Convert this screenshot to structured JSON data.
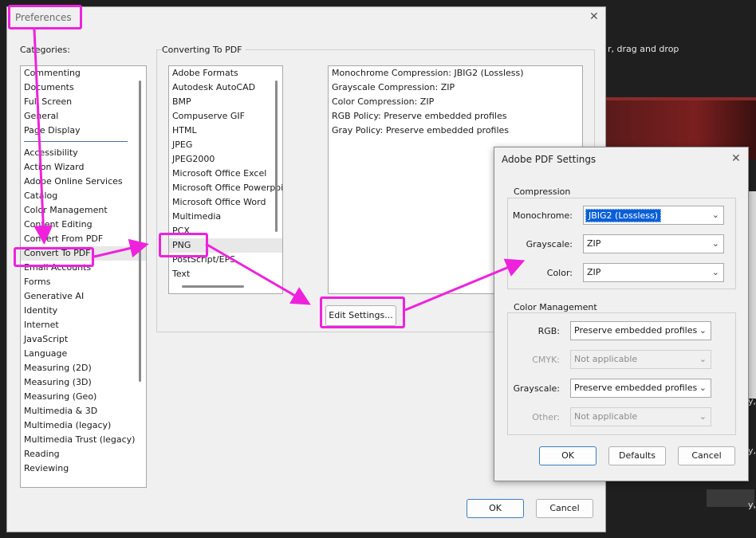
{
  "background": {
    "hint_text": "r, drag and drop",
    "edge_snips": [
      "y,",
      "y,",
      "y,"
    ]
  },
  "preferences": {
    "title": "Preferences",
    "categories_label": "Categories:",
    "categories_top": [
      "Commenting",
      "Documents",
      "Full Screen",
      "General",
      "Page Display"
    ],
    "categories": [
      "Accessibility",
      "Action Wizard",
      "Adobe Online Services",
      "Catalog",
      "Color Management",
      "Content Editing",
      "Convert From PDF",
      "Convert To PDF",
      "Email Accounts",
      "Forms",
      "Generative AI",
      "Identity",
      "Internet",
      "JavaScript",
      "Language",
      "Measuring (2D)",
      "Measuring (3D)",
      "Measuring (Geo)",
      "Multimedia & 3D",
      "Multimedia (legacy)",
      "Multimedia Trust (legacy)",
      "Reading",
      "Reviewing"
    ],
    "selected_category": "Convert To PDF",
    "section_title": "Converting To PDF",
    "formats": [
      "Adobe Formats",
      "Autodesk AutoCAD",
      "BMP",
      "Compuserve GIF",
      "HTML",
      "JPEG",
      "JPEG2000",
      "Microsoft Office Excel",
      "Microsoft Office Powerpoint",
      "Microsoft Office Word",
      "Multimedia",
      "PCX",
      "PNG",
      "PostScript/EPS",
      "Text"
    ],
    "selected_format": "PNG",
    "settings": [
      "Monochrome Compression: JBIG2 (Lossless)",
      "Grayscale Compression: ZIP",
      "Color Compression: ZIP",
      "RGB Policy: Preserve embedded profiles",
      "Gray Policy: Preserve embedded profiles"
    ],
    "edit_settings_label": "Edit Settings...",
    "ok_label": "OK",
    "cancel_label": "Cancel"
  },
  "pdf_settings": {
    "title": "Adobe PDF Settings",
    "compression_title": "Compression",
    "monochrome_label": "Monochrome:",
    "monochrome_value": "JBIG2 (Lossless)",
    "grayscale_label": "Grayscale:",
    "grayscale_value": "ZIP",
    "color_label": "Color:",
    "color_value": "ZIP",
    "color_management_title": "Color Management",
    "rgb_label": "RGB:",
    "rgb_value": "Preserve embedded profiles",
    "cmyk_label": "CMYK:",
    "cmyk_value": "Not applicable",
    "cm_grayscale_label": "Grayscale:",
    "cm_grayscale_value": "Preserve embedded profiles",
    "other_label": "Other:",
    "other_value": "Not applicable",
    "ok_label": "OK",
    "defaults_label": "Defaults",
    "cancel_label": "Cancel"
  },
  "icons": {
    "close": "close-icon",
    "dropdown": "chevron-down-icon"
  },
  "colors": {
    "annotation": "#ee22dd",
    "selection": "#0a5fd6",
    "separator": "#4a6fa0"
  }
}
